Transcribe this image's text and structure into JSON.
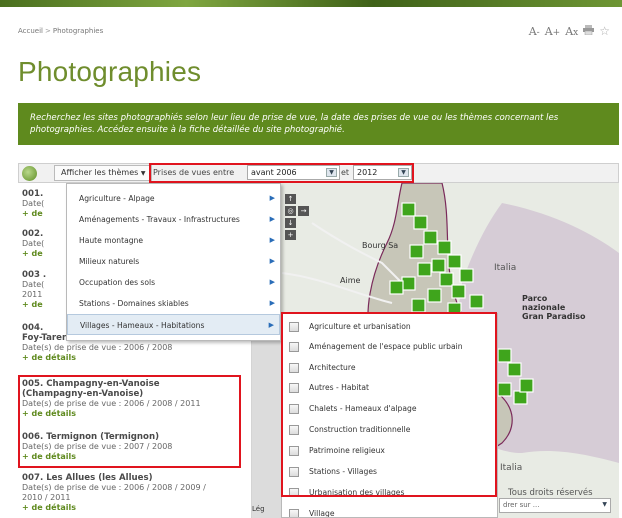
{
  "breadcrumb": {
    "home": "Accueil",
    "separator": ">",
    "current": "Photographies"
  },
  "tools": {
    "a1": "A",
    "a2": "A",
    "a3": "A",
    "print_icon": "print-icon",
    "fav_icon": "star-icon"
  },
  "page_title": "Photographies",
  "intro": "Recherchez les sites photographiés selon leur lieu de prise de vue, la date des prises de vue ou les thèmes concernant les photographies. Accédez ensuite à la fiche détaillée du site photographié.",
  "toolbar": {
    "themes_label": "Afficher les thèmes",
    "prise_label": "Prises de vues entre",
    "from_value": "avant 2006",
    "and_label": "et",
    "to_value": "2012"
  },
  "list": {
    "items": [
      {
        "title": "001.",
        "date": "Date(",
        "more": "+ de"
      },
      {
        "title": "002.",
        "date": "Date(",
        "more": "+ de"
      },
      {
        "title": "003 .",
        "date": "Date(",
        "date2": "2011",
        "more": "+ de"
      },
      {
        "title": "004.",
        "title2": "Foy-Tarentaise)",
        "date": "Date(s) de prise de vue : 2006 / 2008",
        "more": "+ de détails"
      },
      {
        "title": "005. Champagny-en-Vanoise",
        "title2": "(Champagny-en-Vanoise)",
        "date": "Date(s) de prise de vue : 2006 / 2008 / 2011",
        "more": "+ de détails"
      },
      {
        "title": "006. Termignon (Termignon)",
        "date": "Date(s) de prise de vue : 2007 / 2008",
        "more": "+ de détails"
      },
      {
        "title": "007. Les Allues (les Allues)",
        "date": "Date(s) de prise de vue : 2006 / 2008 / 2009 /",
        "date2": "2010 / 2011",
        "more": "+ de détails"
      }
    ]
  },
  "menu": {
    "items": [
      "Agriculture - Alpage",
      "Aménagements - Travaux - Infrastructures",
      "Haute montagne",
      "Milieux naturels",
      "Occupation des sols",
      "Stations - Domaines skiables",
      "Villages - Hameaux - Habitations"
    ]
  },
  "submenu": {
    "items": [
      "Agriculture et urbanisation",
      "Aménagement de l'espace public urbain",
      "Architecture",
      "Autres - Habitat",
      "Chalets - Hameaux d'alpage",
      "Construction traditionnelle",
      "Patrimoine religieux",
      "Stations - Villages",
      "Urbanisation des villages",
      "Village"
    ]
  },
  "map": {
    "labels": {
      "bourg": "Bourg Sa",
      "aime": "Aime",
      "italia1": "Italia",
      "parco1": "Parco",
      "parco2": "nazionale",
      "parco3": "Gran Paradiso",
      "italia2": "Italia",
      "rights": "Tous droits réservés",
      "legend": "Lég",
      "filter": "drer sur ..."
    }
  },
  "colors": {
    "accent_green": "#5f8a1e",
    "title_green": "#6f8d2d",
    "highlight_red": "#e0141e",
    "marker_green": "#3fa51c"
  }
}
